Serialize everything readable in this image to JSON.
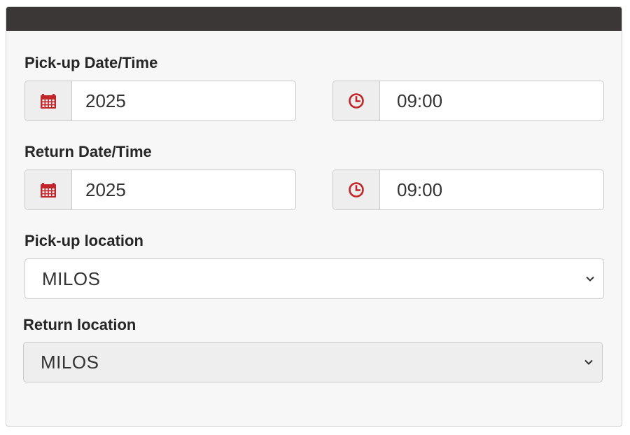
{
  "pickup": {
    "label": "Pick-up Date/Time",
    "date_value": "2025",
    "time_value": "09:00"
  },
  "return": {
    "label": "Return Date/Time",
    "date_value": "2025",
    "time_value": "09:00"
  },
  "pickup_location": {
    "label": "Pick-up location",
    "selected": "MILOS"
  },
  "return_location": {
    "label": "Return location",
    "selected": "MILOS"
  },
  "colors": {
    "header": "#3b3736",
    "icon_accent": "#c0262a",
    "panel_bg": "#f7f7f7"
  },
  "icons": {
    "date": "calendar-icon",
    "time": "clock-icon",
    "dropdown": "chevron-down-icon"
  }
}
